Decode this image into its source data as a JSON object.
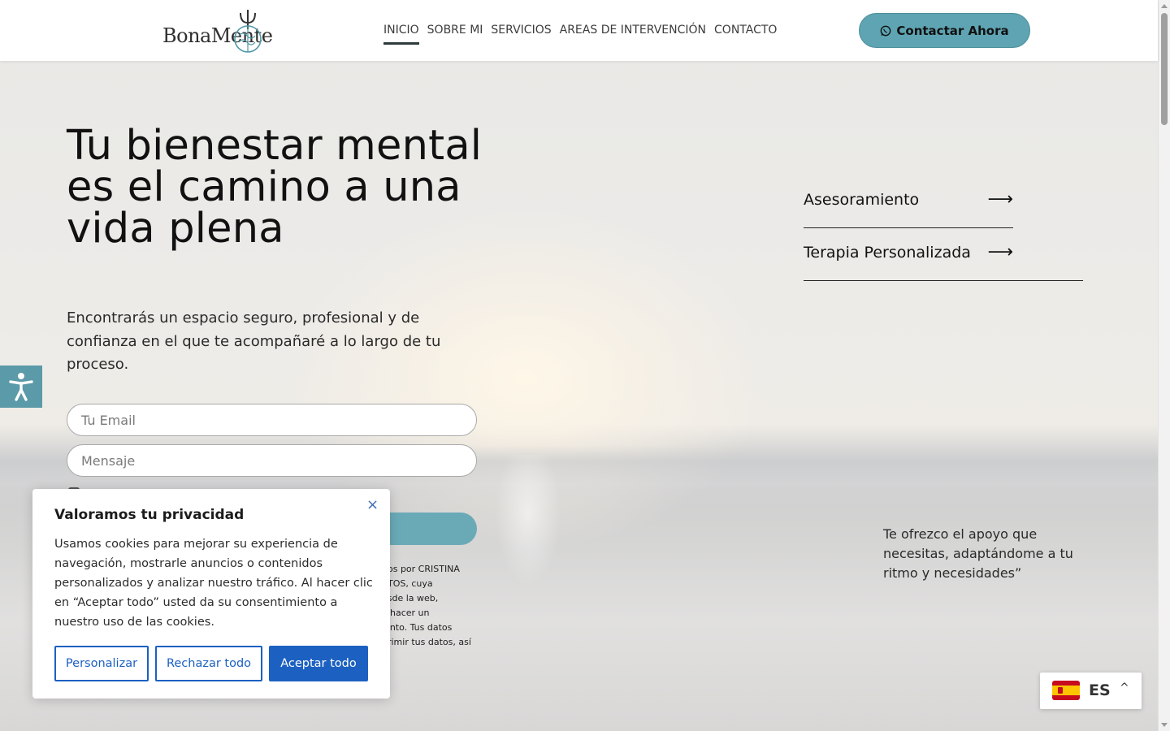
{
  "header": {
    "logo_text": "BonaMente",
    "nav": [
      {
        "label": "INICIO",
        "active": true
      },
      {
        "label": "SOBRE MI",
        "active": false
      },
      {
        "label": "SERVICIOS",
        "active": false
      },
      {
        "label": "AREAS DE INTERVENCIÓN",
        "active": false
      },
      {
        "label": "CONTACTO",
        "active": false
      }
    ],
    "cta_label": "Contactar Ahora",
    "cta_icon": "whatsapp-icon"
  },
  "hero": {
    "headline": "Tu bienestar mental es el camino a una vida plena",
    "subtext": "Encontrarás un espacio seguro, profesional y de confianza en el que te acompañaré a lo largo de tu proceso.",
    "form": {
      "email_placeholder": "Tu Email",
      "message_placeholder": "Mensaje"
    },
    "legal_fragment": "dos por CRISTINA\nSTOS, cuya\nesde la web,\ny hacer un\niento. Tus datos\nprimir tus datos, así\nd:"
  },
  "side_links": [
    {
      "label": "Asesoramiento",
      "arrow": "⟶"
    },
    {
      "label": "Terapia Personalizada",
      "arrow": "⟶"
    }
  ],
  "quote": "Te ofrezco el apoyo que necesitas, adaptándome a tu ritmo y necesidades”",
  "cookie": {
    "title": "Valoramos tu privacidad",
    "close": "×",
    "text": "Usamos cookies para mejorar su experiencia de navegación, mostrarle anuncios o contenidos personalizados y analizar nuestro tráfico. Al hacer clic en “Aceptar todo” usted da su consentimiento a nuestro uso de las cookies.",
    "btn_customize": "Personalizar",
    "btn_reject": "Rechazar todo",
    "btn_accept": "Aceptar todo"
  },
  "language": {
    "code": "ES",
    "caret": "^"
  },
  "colors": {
    "accent": "#5ea4b2",
    "cookie_blue": "#1c61c2"
  }
}
